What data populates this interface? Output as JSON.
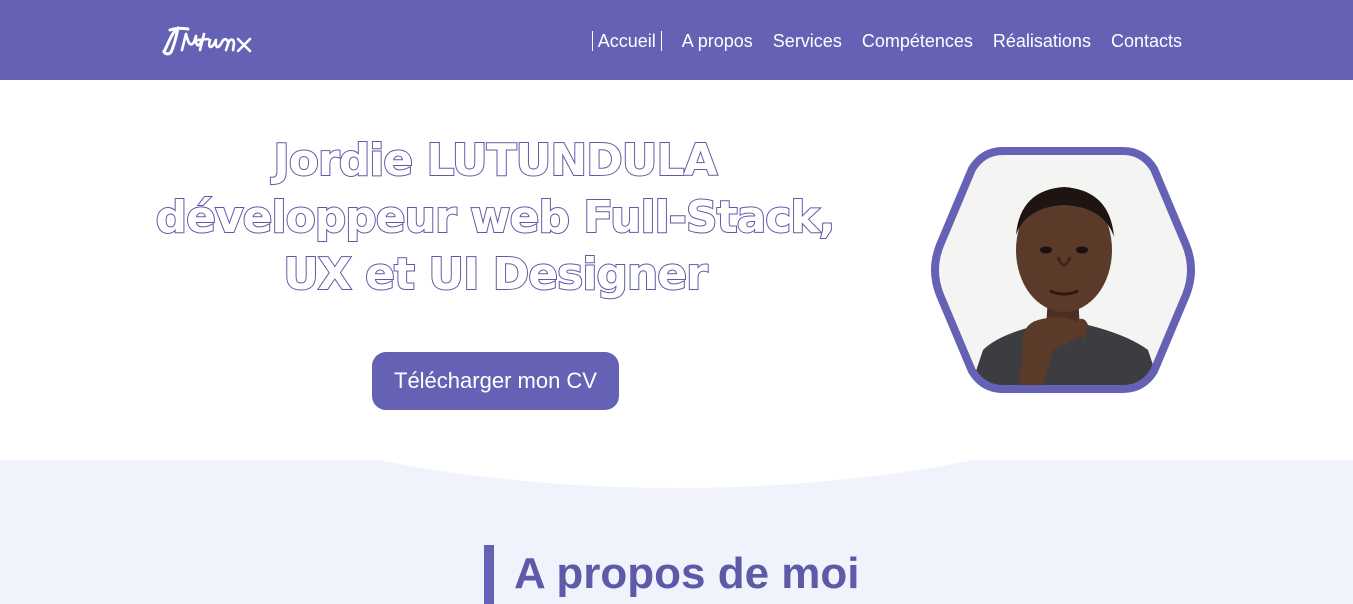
{
  "header": {
    "logo_text": "Jlutunx",
    "nav": [
      "Accueil",
      "A propos",
      "Services",
      "Compétences",
      "Réalisations",
      "Contacts"
    ],
    "active_index": 0
  },
  "hero": {
    "title_lines": [
      "Jordie LUTUNDULA",
      "développeur web Full-Stack,",
      "UX et UI Designer"
    ],
    "cv_button": "Télécharger mon CV",
    "photo_icon": "profile-photo"
  },
  "about": {
    "title": "A propos de moi"
  },
  "colors": {
    "primary": "#6562b5",
    "section_bg": "#f0f3fb",
    "title_outline": "#5d5aa8"
  }
}
